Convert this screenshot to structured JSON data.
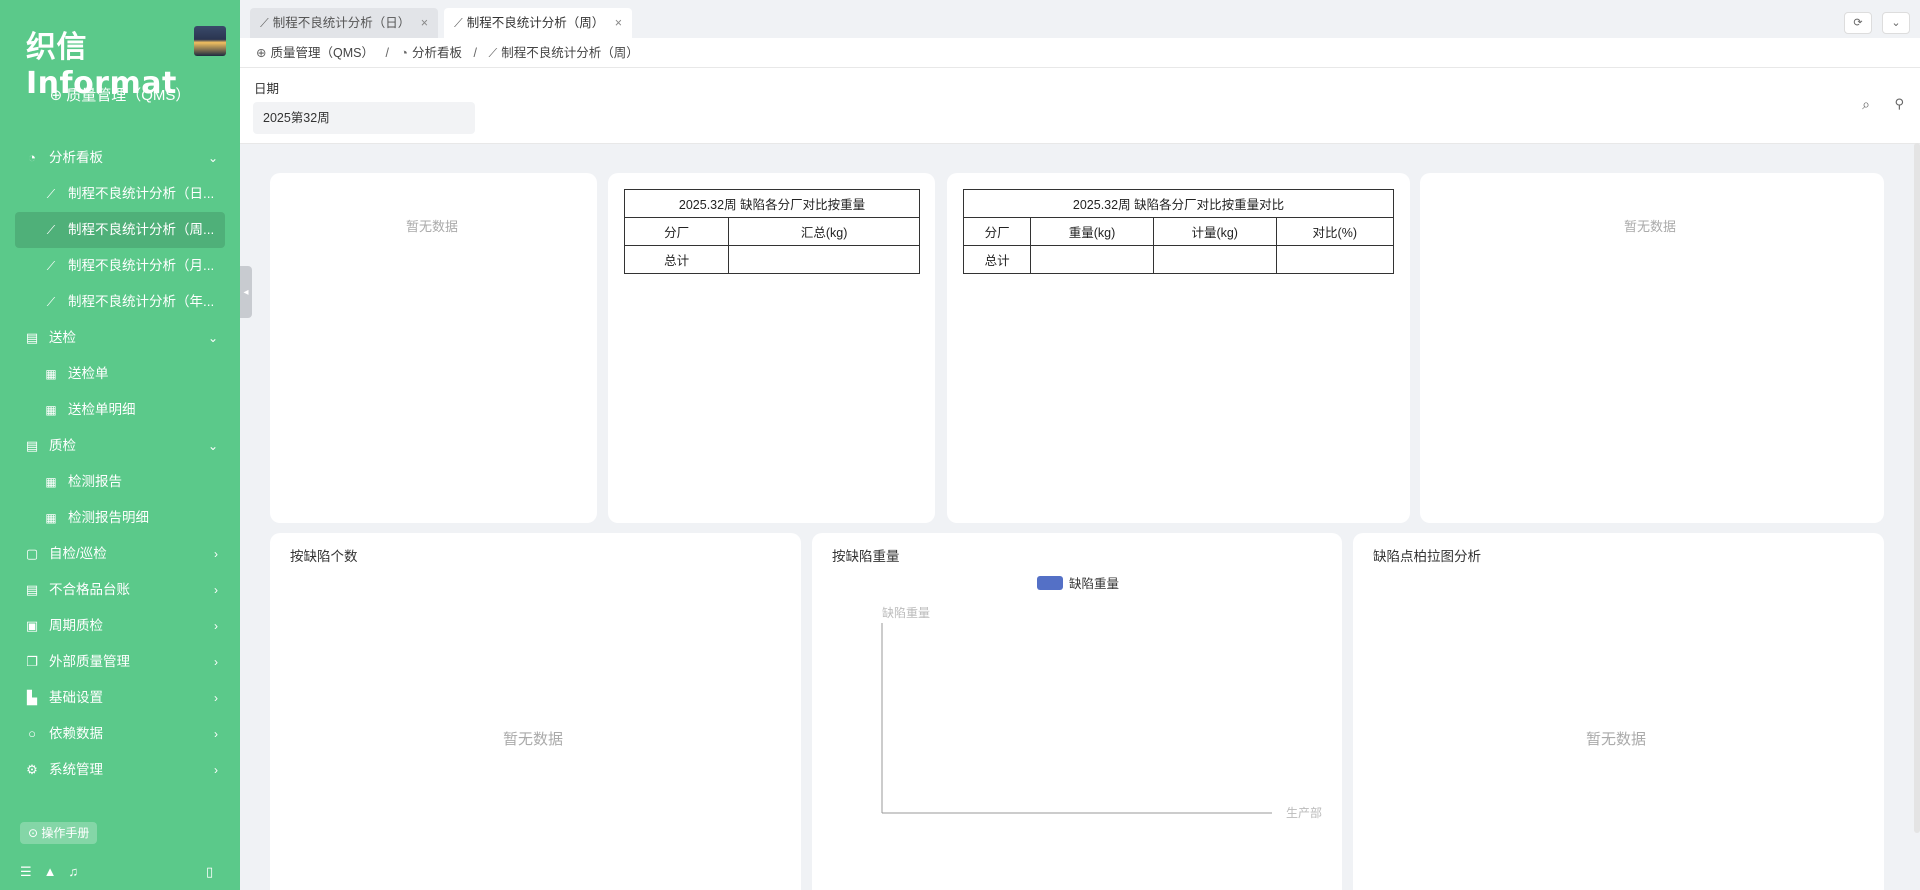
{
  "sidebar": {
    "logo_text": "织信 Informat",
    "app_name": "质量管理（QMS）",
    "menu": [
      {
        "label": "分析看板",
        "icon": "dashboard-icon",
        "arrow": "⌄",
        "type": "group"
      },
      {
        "label": "制程不良统计分析（日...",
        "icon": "line-chart-icon",
        "type": "sub"
      },
      {
        "label": "制程不良统计分析（周...",
        "icon": "line-chart-icon",
        "type": "sub",
        "active": true
      },
      {
        "label": "制程不良统计分析（月...",
        "icon": "line-chart-icon",
        "type": "sub"
      },
      {
        "label": "制程不良统计分析（年...",
        "icon": "line-chart-icon",
        "type": "sub"
      },
      {
        "label": "送检",
        "icon": "document-icon",
        "arrow": "⌄",
        "type": "group"
      },
      {
        "label": "送检单",
        "icon": "table-icon",
        "type": "sub"
      },
      {
        "label": "送检单明细",
        "icon": "table-icon",
        "type": "sub"
      },
      {
        "label": "质检",
        "icon": "document-icon",
        "arrow": "⌄",
        "type": "group"
      },
      {
        "label": "检测报告",
        "icon": "table-icon",
        "type": "sub"
      },
      {
        "label": "检测报告明细",
        "icon": "table-icon",
        "type": "sub"
      },
      {
        "label": "自检/巡检",
        "icon": "file-check-icon",
        "arrow": "›",
        "type": "group"
      },
      {
        "label": "不合格品台账",
        "icon": "ledger-icon",
        "arrow": "›",
        "type": "group"
      },
      {
        "label": "周期质检",
        "icon": "calendar-icon",
        "arrow": "›",
        "type": "group"
      },
      {
        "label": "外部质量管理",
        "icon": "copy-icon",
        "arrow": "›",
        "type": "group"
      },
      {
        "label": "基础设置",
        "icon": "building-icon",
        "arrow": "›",
        "type": "group"
      },
      {
        "label": "依赖数据",
        "icon": "circle-icon",
        "arrow": "›",
        "type": "group"
      },
      {
        "label": "系统管理",
        "icon": "gear-icon",
        "arrow": "›",
        "type": "group"
      }
    ],
    "manual_label": "操作手册"
  },
  "tabs": [
    {
      "label": "制程不良统计分析（日）",
      "close": "×"
    },
    {
      "label": "制程不良统计分析（周）",
      "close": "×"
    }
  ],
  "breadcrumb": [
    "质量管理（QMS）",
    "分析看板",
    "制程不良统计分析（周）"
  ],
  "filter": {
    "label": "日期",
    "value": "2025第32周"
  },
  "cards": {
    "no_data": "暂无数据",
    "table1": {
      "caption": "2025.32周 缺陷各分厂对比按重量",
      "headers": [
        "分厂",
        "汇总(kg)"
      ],
      "total_label": "总计"
    },
    "table2": {
      "caption": "2025.32周 缺陷各分厂对比按重量对比",
      "headers": [
        "分厂",
        "重量(kg)",
        "计量(kg)",
        "对比(%)"
      ],
      "total_label": "总计"
    },
    "count_title": "按缺陷个数",
    "weight_title": "按缺陷重量",
    "pareto_title": "缺陷点柏拉图分析"
  },
  "chart_data": {
    "type": "bar",
    "title": "按缺陷重量",
    "ylabel": "缺陷重量",
    "categories": [
      "生产部"
    ],
    "series": [
      {
        "name": "缺陷重量",
        "values": [],
        "color": "#5470c6"
      }
    ]
  }
}
